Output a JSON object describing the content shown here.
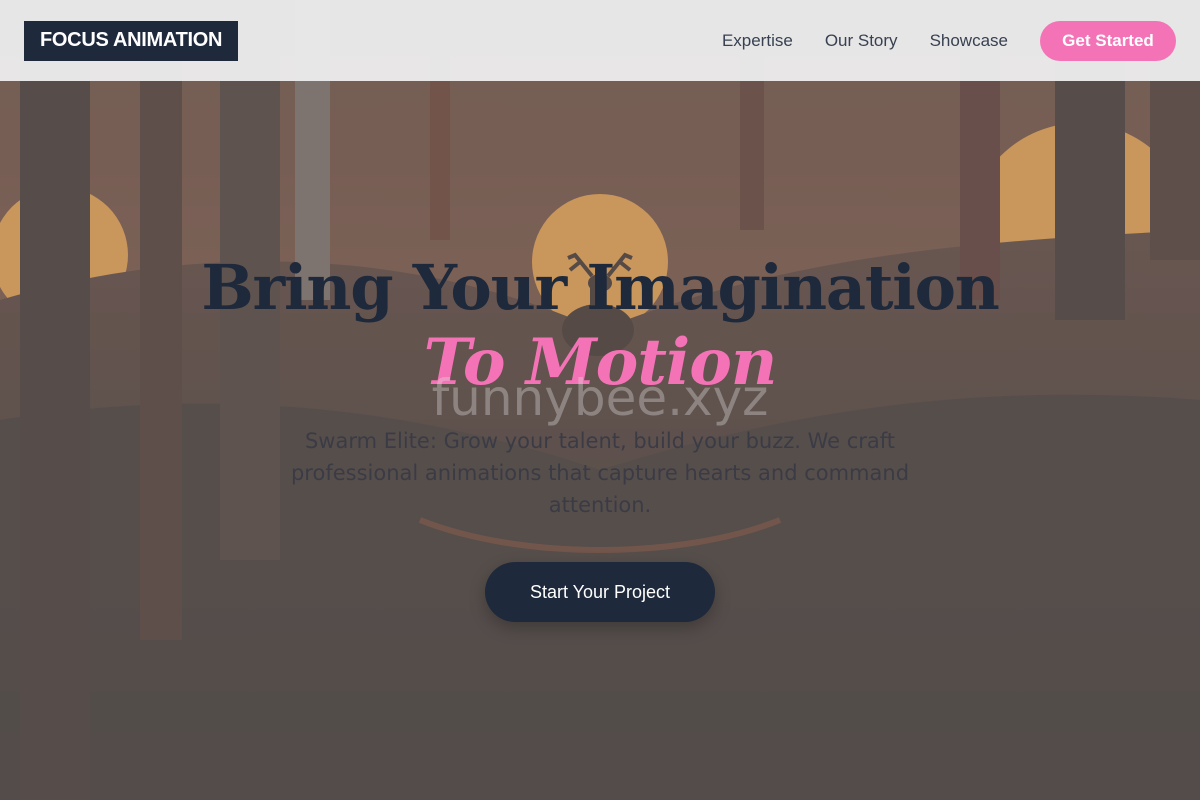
{
  "header": {
    "logo": "FOCUS ANIMATION",
    "nav": [
      {
        "label": "Expertise"
      },
      {
        "label": "Our Story"
      },
      {
        "label": "Showcase"
      }
    ],
    "cta_label": "Get Started"
  },
  "hero": {
    "headline": "Bring Your Imagination",
    "subheadline": "To Motion",
    "watermark": "funnybee.xyz",
    "description": "Swarm Elite: Grow your talent, build your buzz. We craft professional animations that capture hearts and command attention.",
    "button_label": "Start Your Project"
  },
  "colors": {
    "brand_dark": "#1e293b",
    "accent_pink": "#f472b6",
    "header_bg": "#ececec"
  },
  "icons": {
    "background": "forest-sunset-deer-image"
  }
}
